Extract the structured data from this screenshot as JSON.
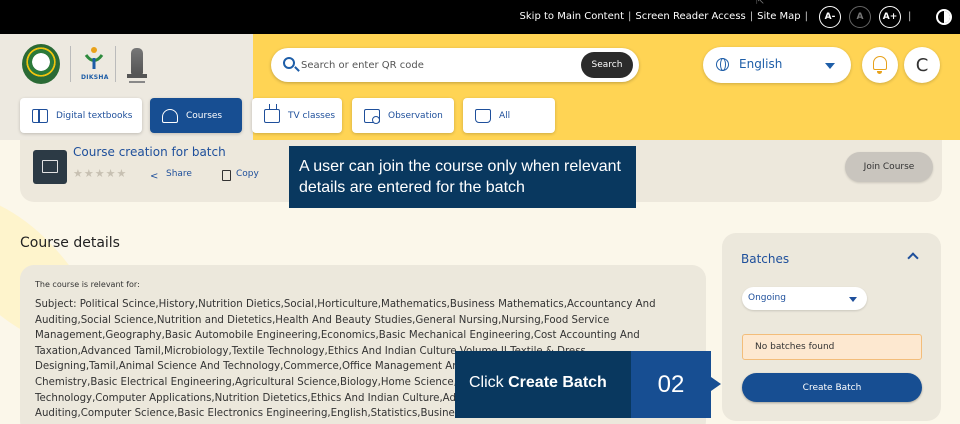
{
  "topbar": {
    "links": [
      "Skip to Main Content",
      "Screen Reader Access",
      "Site Map"
    ],
    "font_controls": [
      "A-",
      "A",
      "A+"
    ]
  },
  "header": {
    "diksha_label": "DIKSHA",
    "search": {
      "placeholder": "Search or enter QR code",
      "button": "Search"
    },
    "language": "English",
    "avatar_initial": "C"
  },
  "nav": {
    "tabs": [
      {
        "label": "Digital textbooks",
        "active": false
      },
      {
        "label": "Courses",
        "active": true
      },
      {
        "label": "TV classes",
        "active": false
      },
      {
        "label": "Observation",
        "active": false
      },
      {
        "label": "All",
        "active": false
      }
    ]
  },
  "course": {
    "title": "Course creation for batch",
    "stars": "★★★★★",
    "share": "Share",
    "copy": "Copy",
    "join": "Join Course"
  },
  "tooltip_join": "A user can join the course only when relevant details are entered for the batch",
  "details": {
    "title": "Course details",
    "relevant_for": "The course is relevant for:",
    "subject": "Subject: Political Scince,History,Nutrition Dietics,Social,Horticulture,Mathematics,Business Mathematics,Accountancy And Auditing,Social Science,Nutrition and Dietetics,Health And Beauty Studies,General Nursing,Nursing,Food Service Management,Geography,Basic Automobile Engineering,Economics,Basic Mechanical Engineering,Cost Accounting And Taxation,Advanced Tamil,Microbiology,Textile Technology,Ethics And Indian Culture Volume II,Textile & Dress Designing,Tamil,Animal Science And Technology,Commerce,Office Management And Secretaryship,Food Technology,Science,Bio Chemistry,Basic Electrical Engineering,Agricultural Science,Biology,Home Science,Textile And Dress Designing,Chemical Technology,Computer Applications,Nutrition Dietetics,Ethics And Indian Culture,Advance Tamil,Accounting And Auditing,Computer Science,Basic Electronics Engineering,English,Statistics,Business"
  },
  "batches": {
    "title": "Batches",
    "filter": "Ongoing",
    "empty": "No batches found",
    "create": "Create Batch"
  },
  "callout": {
    "prefix": "Click ",
    "bold": "Create Batch",
    "step": "02"
  },
  "colors": {
    "primary_blue": "#174e92",
    "header_yellow": "#ffd454",
    "callout_navy": "#09385f"
  }
}
